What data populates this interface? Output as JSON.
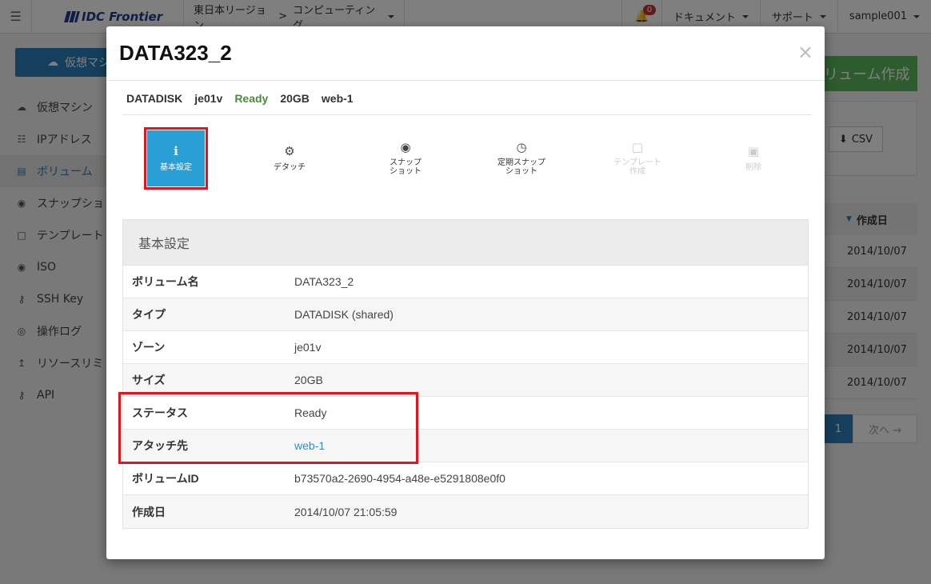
{
  "topbar": {
    "logo": "IDC Frontier",
    "region": "東日本リージョン",
    "region_sep": ">",
    "service": "コンピューティング",
    "notification_count": "0",
    "documents": "ドキュメント",
    "support": "サポート",
    "user": "sample001"
  },
  "sidebar": {
    "create_vm": "仮想マシ",
    "items": [
      {
        "label": "仮想マシン",
        "icon": "cloud-icon"
      },
      {
        "label": "IPアドレス",
        "icon": "sitemap-icon"
      },
      {
        "label": "ボリューム",
        "icon": "hdd-icon"
      },
      {
        "label": "スナップショ",
        "icon": "camera-icon"
      },
      {
        "label": "テンプレート",
        "icon": "file-icon"
      },
      {
        "label": "ISO",
        "icon": "disc-icon"
      },
      {
        "label": "SSH Key",
        "icon": "key-icon"
      },
      {
        "label": "操作ログ",
        "icon": "eye-icon"
      },
      {
        "label": "リソースリミ",
        "icon": "level-up-icon"
      },
      {
        "label": "API",
        "icon": "key-icon"
      }
    ]
  },
  "background": {
    "create_volume": "リューム作成",
    "csv": "CSV",
    "col_created": "作成日",
    "dates": [
      "2014/10/07",
      "2014/10/07",
      "2014/10/07",
      "2014/10/07",
      "2014/10/07"
    ],
    "page": "1",
    "next": "次へ →"
  },
  "modal": {
    "title": "DATA323_2",
    "close": "×",
    "summary": {
      "type": "DATADISK",
      "zone": "je01v",
      "status": "Ready",
      "size": "20GB",
      "attached": "web-1"
    },
    "actions": [
      {
        "label": "基本設定",
        "icon": "info-icon"
      },
      {
        "label": "デタッチ",
        "icon": "gear-icon"
      },
      {
        "label": "スナップ\nショット",
        "icon": "camera-icon"
      },
      {
        "label": "定期スナップ\nショット",
        "icon": "clock-icon"
      },
      {
        "label": "テンプレート\n作成",
        "icon": "file-icon"
      },
      {
        "label": "削除",
        "icon": "trash-icon"
      }
    ],
    "panel": {
      "heading": "基本設定",
      "rows": [
        {
          "key": "ボリューム名",
          "value": "DATA323_2"
        },
        {
          "key": "タイプ",
          "value": "DATADISK (shared)"
        },
        {
          "key": "ゾーン",
          "value": "je01v"
        },
        {
          "key": "サイズ",
          "value": "20GB"
        },
        {
          "key": "ステータス",
          "value": "Ready"
        },
        {
          "key": "アタッチ先",
          "value": "web-1"
        },
        {
          "key": "ボリュームID",
          "value": "b73570a2-2690-4954-a48e-e5291808e0f0"
        },
        {
          "key": "作成日",
          "value": "2014/10/07 21:05:59"
        }
      ]
    }
  },
  "colors": {
    "accent": "#2a9fd6",
    "highlight": "#e0151e",
    "ready": "#4a8c3b",
    "create": "#5cb85c"
  }
}
